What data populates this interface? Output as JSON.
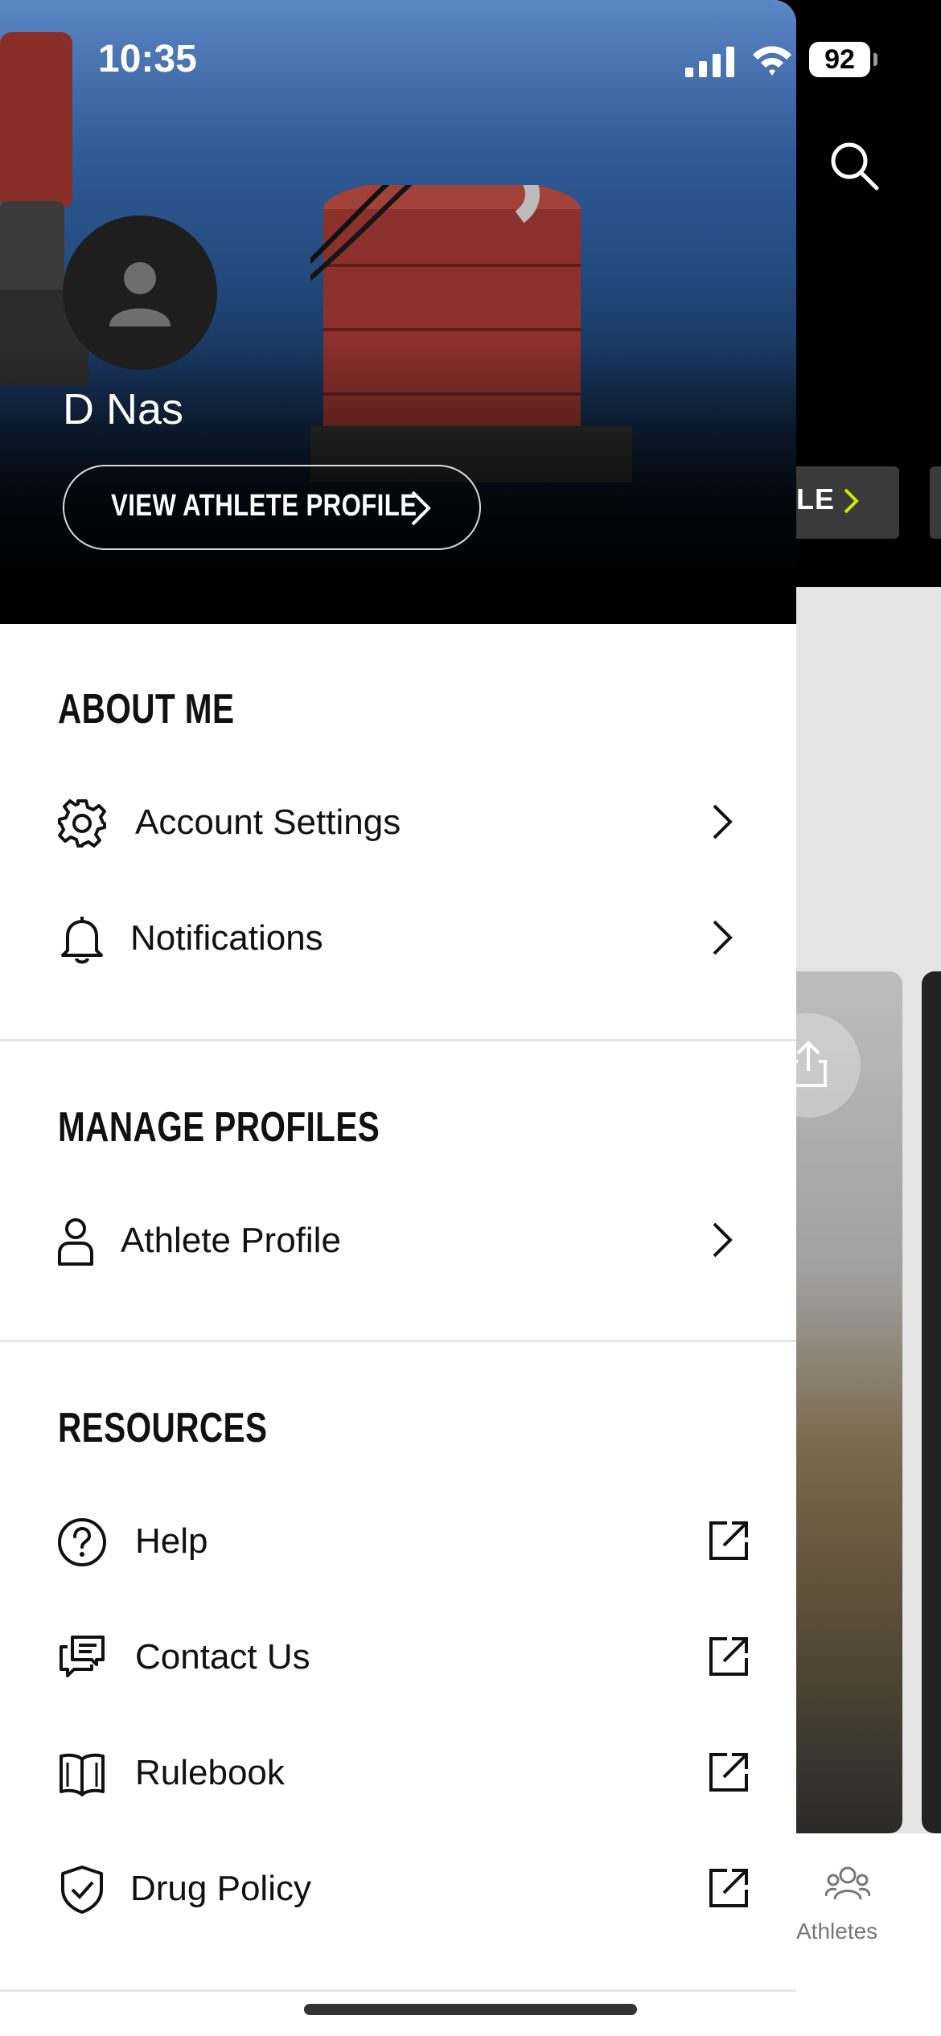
{
  "status_bar": {
    "time": "10:35",
    "battery": "92"
  },
  "background": {
    "filter_pill_label": "LE",
    "bottom_nav": {
      "athletes_label": "Athletes"
    }
  },
  "drawer": {
    "user_name": "D Nas",
    "view_profile_label": "VIEW ATHLETE PROFILE",
    "sections": {
      "about_me": {
        "title": "ABOUT ME",
        "items": [
          {
            "label": "Account Settings",
            "icon": "gear-icon",
            "action": "chevron-right-icon"
          },
          {
            "label": "Notifications",
            "icon": "bell-icon",
            "action": "chevron-right-icon"
          }
        ]
      },
      "manage_profiles": {
        "title": "MANAGE PROFILES",
        "items": [
          {
            "label": "Athlete Profile",
            "icon": "person-icon",
            "action": "chevron-right-icon"
          }
        ]
      },
      "resources": {
        "title": "RESOURCES",
        "items": [
          {
            "label": "Help",
            "icon": "question-circle-icon",
            "action": "external-link-icon"
          },
          {
            "label": "Contact Us",
            "icon": "chat-icon",
            "action": "external-link-icon"
          },
          {
            "label": "Rulebook",
            "icon": "book-icon",
            "action": "external-link-icon"
          },
          {
            "label": "Drug Policy",
            "icon": "shield-check-icon",
            "action": "external-link-icon"
          }
        ]
      }
    }
  }
}
